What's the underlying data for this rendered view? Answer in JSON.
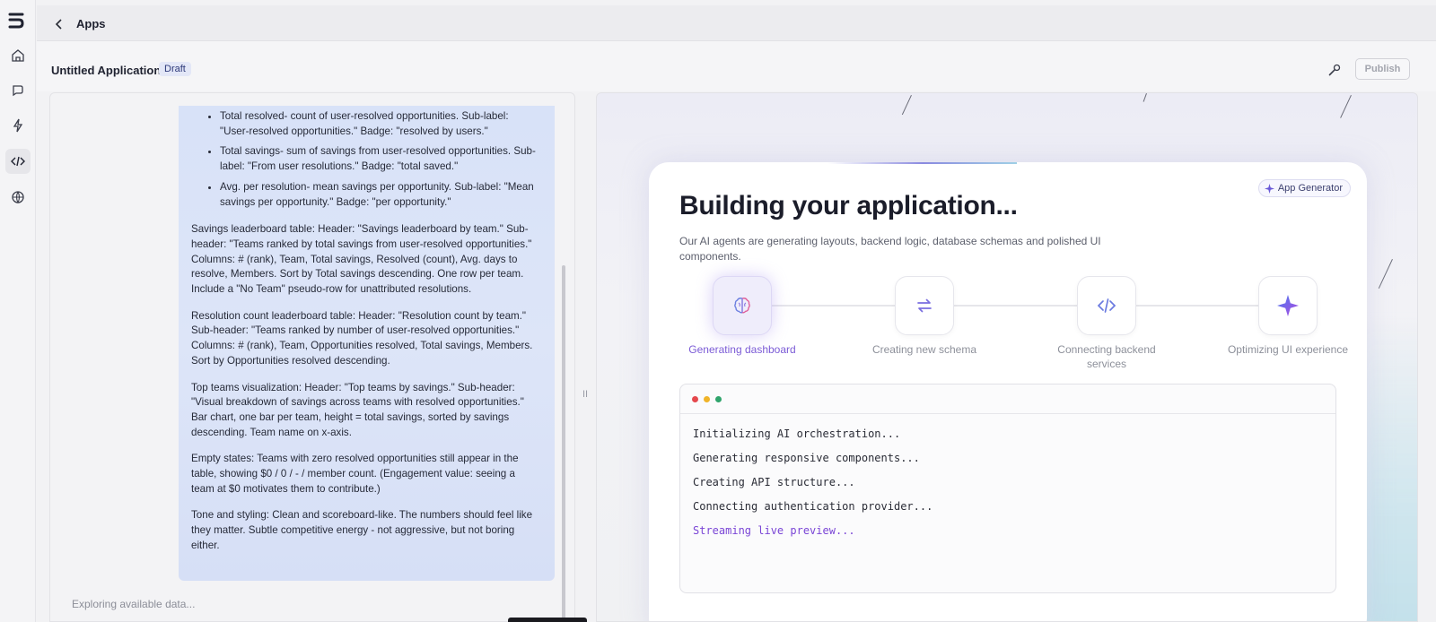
{
  "topbar": {
    "crumb": "Apps"
  },
  "header": {
    "app_title": "Untitled Application",
    "badge": "Draft",
    "publish_label": "Publish"
  },
  "prompt": {
    "bullets": [
      "Total resolved- count of user-resolved opportunities. Sub-label: \"User-resolved opportunities.\" Badge: \"resolved by users.\"",
      "Total savings- sum of savings from user-resolved opportunities. Sub-label: \"From user resolutions.\" Badge: \"total saved.\"",
      "Avg. per resolution- mean savings per opportunity. Sub-label: \"Mean savings per opportunity.\" Badge: \"per opportunity.\""
    ],
    "paragraphs": [
      "Savings leaderboard table: Header: \"Savings leaderboard by team.\" Sub-header: \"Teams ranked by total savings from user-resolved opportunities.\" Columns: # (rank), Team, Total savings, Resolved (count), Avg. days to resolve, Members. Sort by Total savings descending. One row per team. Include a \"No Team\" pseudo-row for unattributed resolutions.",
      "Resolution count leaderboard table: Header: \"Resolution count by team.\" Sub-header: \"Teams ranked by number of user-resolved opportunities.\" Columns: # (rank), Team, Opportunities resolved, Total savings, Members. Sort by Opportunities resolved descending.",
      "Top teams visualization: Header: \"Top teams by savings.\" Sub-header: \"Visual breakdown of savings across teams with resolved opportunities.\" Bar chart, one bar per team, height = total savings, sorted by savings descending. Team name on x-axis.",
      "Empty states: Teams with zero resolved opportunities still appear in the table, showing $0 / 0 / - / member count. (Engagement value: seeing a team at $0 motivates them to contribute.)",
      "Tone and styling: Clean and scoreboard-like. The numbers should feel like they matter. Subtle competitive energy - not aggressive, but not boring either."
    ],
    "status": "Exploring available data..."
  },
  "divider": {
    "handle": "II"
  },
  "builder": {
    "chip": "App Generator",
    "title": "Building your application...",
    "subtitle": "Our AI agents are generating layouts, backend logic, database schemas and polished UI components.",
    "steps": [
      {
        "label": "Generating dashboard",
        "icon": "brain-icon",
        "active": true
      },
      {
        "label": "Creating new schema",
        "icon": "arrows-swap-icon",
        "active": false
      },
      {
        "label": "Connecting backend services",
        "icon": "code-icon",
        "active": false
      },
      {
        "label": "Optimizing UI experience",
        "icon": "sparkle-icon",
        "active": false
      }
    ],
    "terminal": [
      "Initializing AI orchestration...",
      "Generating responsive components...",
      "Creating API structure...",
      "Connecting authentication provider...",
      "Streaming live preview..."
    ]
  },
  "colors": {
    "accent": "#7b5bd6",
    "dot_red": "#e5484d",
    "dot_yellow": "#f0b429",
    "dot_green": "#30a46c"
  }
}
